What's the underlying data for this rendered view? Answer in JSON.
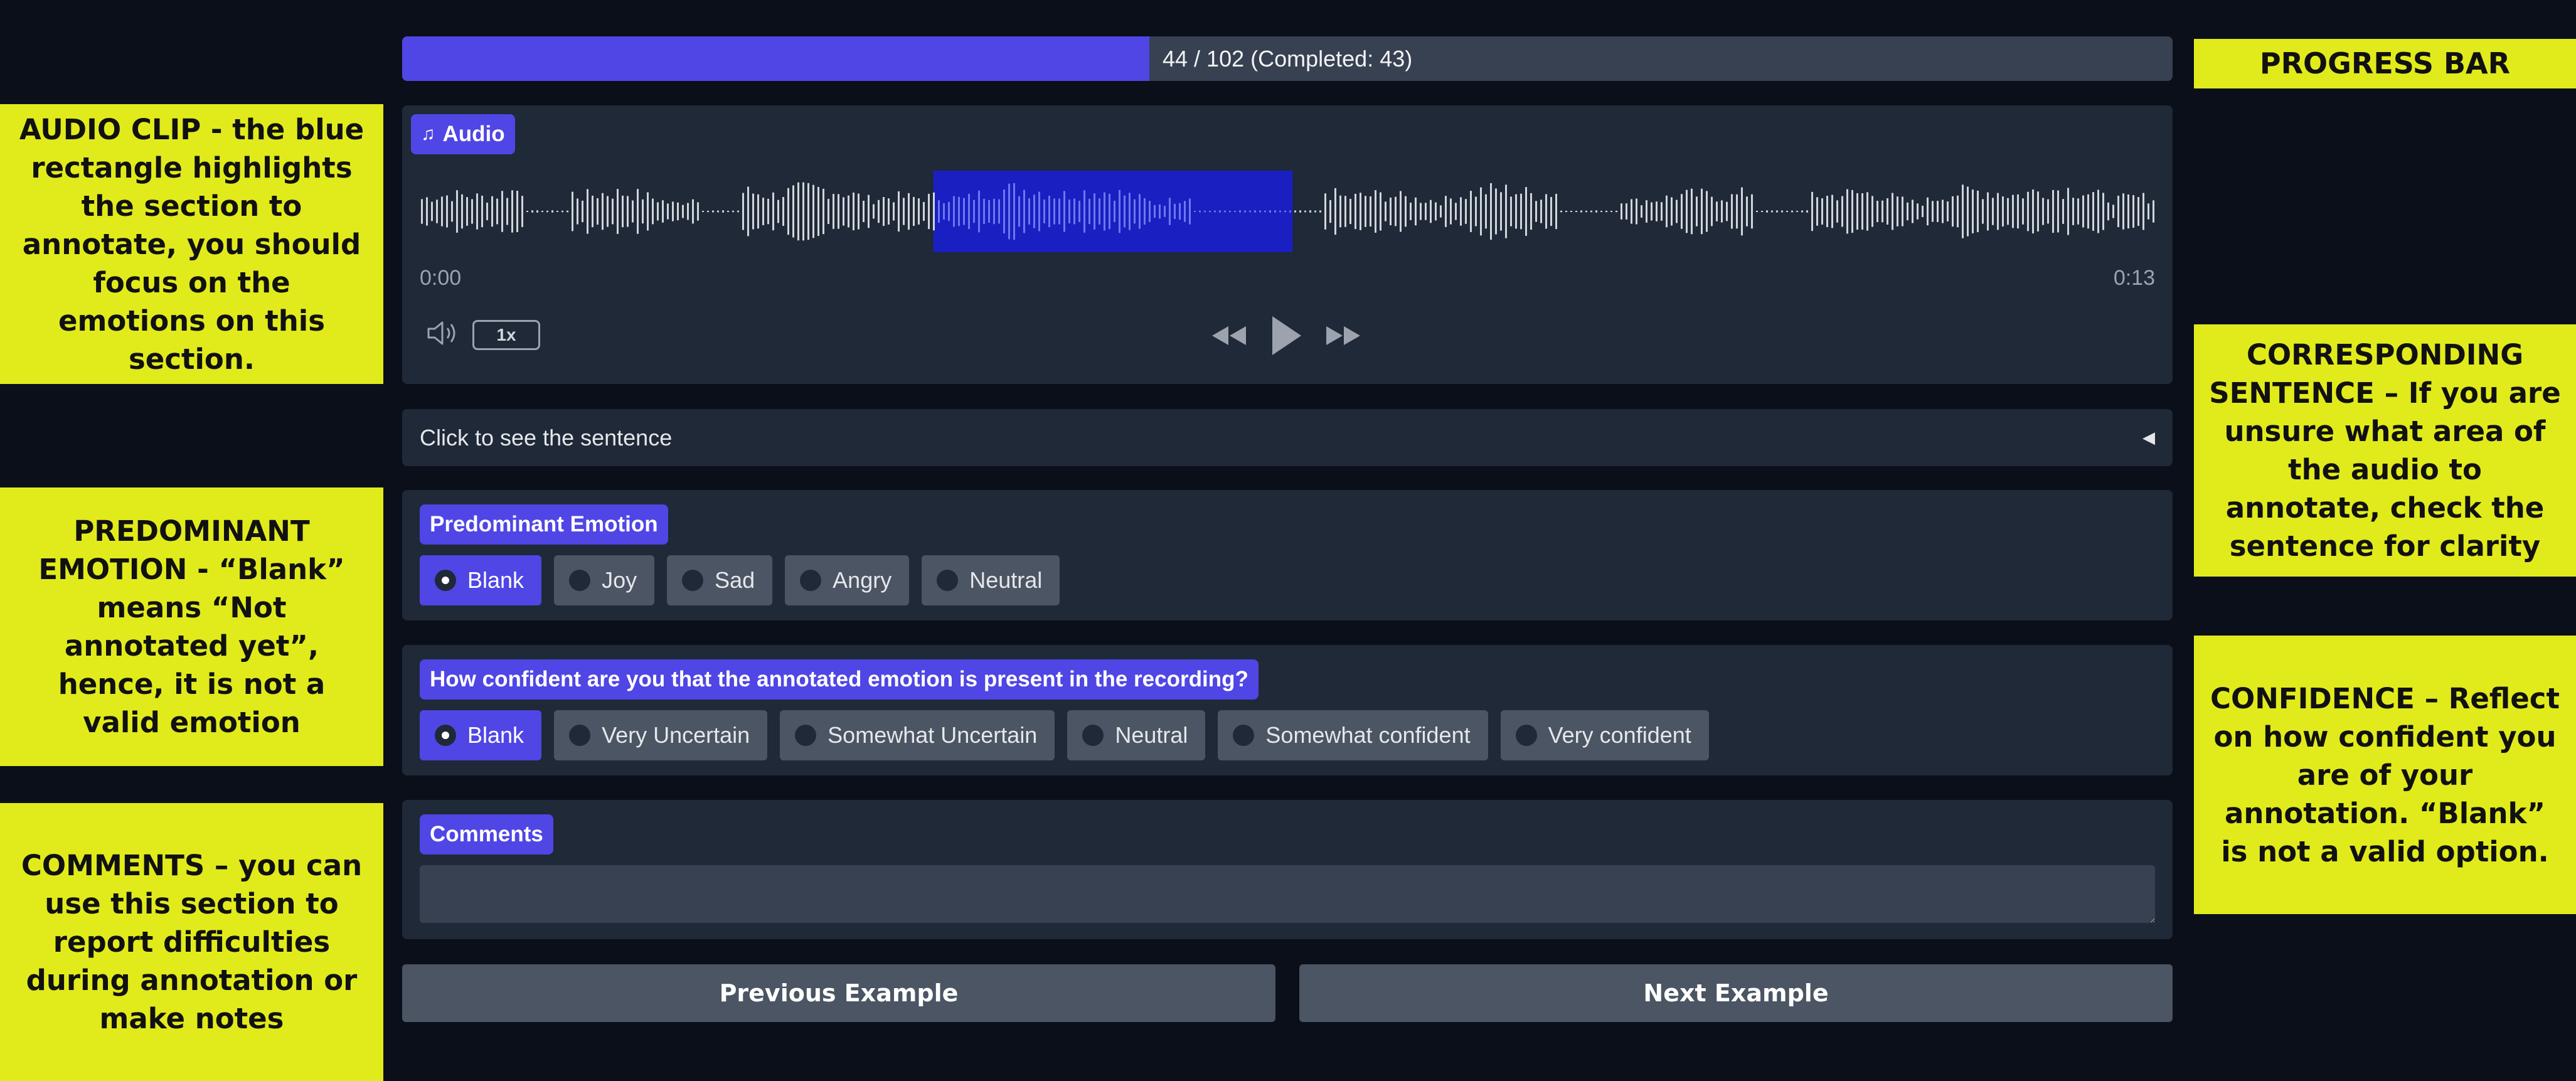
{
  "progress": {
    "text": "44 / 102 (Completed: 43)",
    "current": 44,
    "total": 102,
    "completed": 43,
    "fill_fraction": 0.422
  },
  "audio": {
    "label": "Audio",
    "icon": "music-note-icon",
    "time_start": "0:00",
    "time_end": "0:13",
    "speed": "1x",
    "highlight_start_fraction": 0.296,
    "highlight_end_fraction": 0.503
  },
  "sentence": {
    "label": "Click to see the sentence"
  },
  "emotion": {
    "question": "Predominant Emotion",
    "options": [
      "Blank",
      "Joy",
      "Sad",
      "Angry",
      "Neutral"
    ],
    "selected": "Blank"
  },
  "confidence": {
    "question": "How confident are you that the annotated emotion is present in the recording?",
    "options": [
      "Blank",
      "Very Uncertain",
      "Somewhat Uncertain",
      "Neutral",
      "Somewhat confident",
      "Very confident"
    ],
    "selected": "Blank"
  },
  "comments": {
    "label": "Comments",
    "value": ""
  },
  "nav": {
    "previous": "Previous Example",
    "next": "Next Example"
  },
  "notes": {
    "progress": "PROGRESS BAR",
    "audio": "AUDIO CLIP - the blue rectangle highlights the section to annotate, you should focus on the emotions on this section.",
    "sentence": "CORRESPONDING SENTENCE – If you are unsure what area of the audio to annotate, check the sentence for clarity",
    "emotion": "PREDOMINANT EMOTION - “Blank” means “Not annotated yet”, hence, it is not a valid emotion",
    "confidence": "CONFIDENCE – Reflect on how confident you are of your annotation. “Blank” is not a valid option.",
    "comments": "COMMENTS – you can use this section to report difficulties during annotation or make notes"
  },
  "colors": {
    "accent": "#4f46e5",
    "note_bg": "#e1eb1c",
    "highlight": "#1a1fc2",
    "wave": "#d1d5db"
  }
}
